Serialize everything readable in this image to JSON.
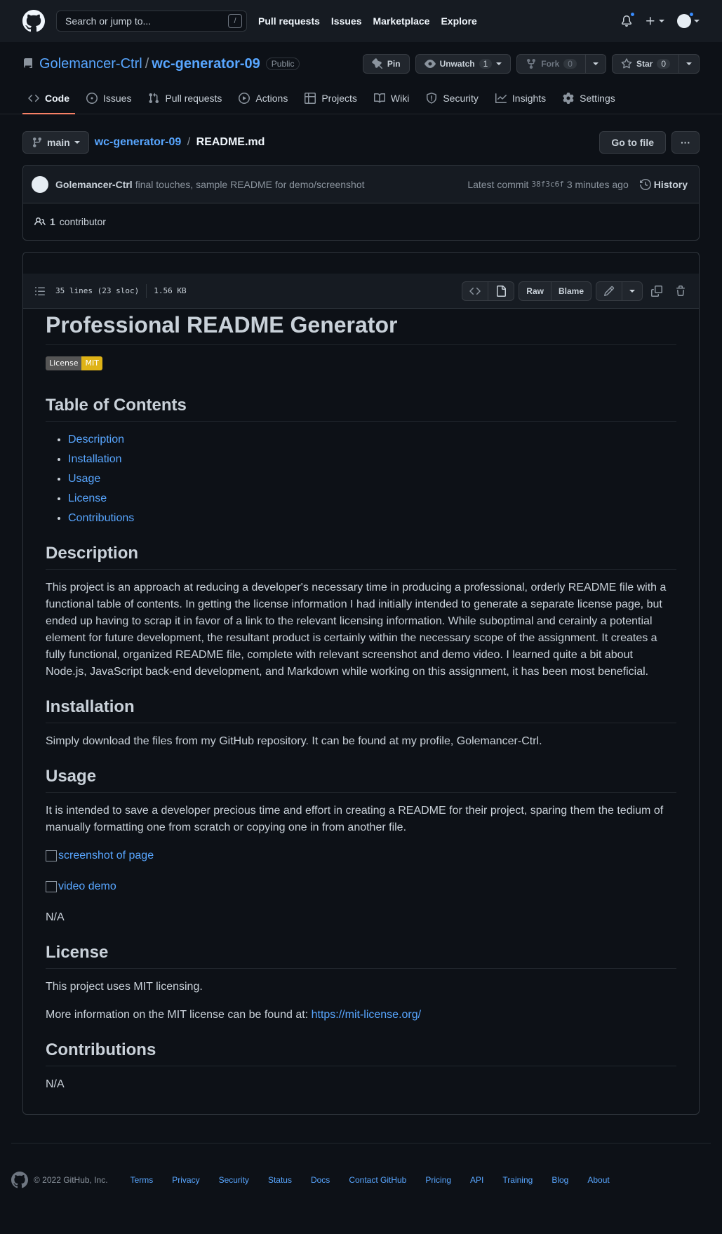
{
  "header": {
    "search_placeholder": "Search or jump to...",
    "slash_key": "/",
    "nav": [
      "Pull requests",
      "Issues",
      "Marketplace",
      "Explore"
    ]
  },
  "repo": {
    "owner": "Golemancer-Ctrl",
    "separator": "/",
    "name": "wc-generator-09",
    "visibility": "Public",
    "pin_label": "Pin",
    "unwatch_label": "Unwatch",
    "unwatch_count": "1",
    "fork_label": "Fork",
    "fork_count": "0",
    "star_label": "Star",
    "star_count": "0"
  },
  "tabs": [
    {
      "label": "Code",
      "icon": "code-icon",
      "active": true
    },
    {
      "label": "Issues",
      "icon": "issue-icon"
    },
    {
      "label": "Pull requests",
      "icon": "pull-request-icon"
    },
    {
      "label": "Actions",
      "icon": "play-icon"
    },
    {
      "label": "Projects",
      "icon": "table-icon"
    },
    {
      "label": "Wiki",
      "icon": "book-icon"
    },
    {
      "label": "Security",
      "icon": "shield-icon"
    },
    {
      "label": "Insights",
      "icon": "graph-icon"
    },
    {
      "label": "Settings",
      "icon": "gear-icon"
    }
  ],
  "file": {
    "branch": "main",
    "repo_crumb": "wc-generator-09",
    "crumb_sep": "/",
    "filename": "README.md",
    "go_to_file": "Go to file",
    "more": "···"
  },
  "commit": {
    "author": "Golemancer-Ctrl",
    "message": "final touches, sample README for demo/screenshot",
    "latest_label": "Latest commit",
    "sha": "38f3c6f",
    "time": "3 minutes ago",
    "history_label": "History",
    "contributors_count": "1",
    "contributors_label": "contributor"
  },
  "fileinfo": {
    "lines": "35 lines (23 sloc)",
    "size": "1.56 KB",
    "raw": "Raw",
    "blame": "Blame"
  },
  "readme": {
    "title": "Professional README Generator",
    "shield_left": "License",
    "shield_right": "MIT",
    "toc_heading": "Table of Contents",
    "toc": [
      "Description",
      "Installation",
      "Usage",
      "License",
      "Contributions"
    ],
    "description_heading": "Description",
    "description": "This project is an approach at reducing a developer's necessary time in producing a professional, orderly README file with a functional table of contents. In getting the license information I had initially intended to generate a separate license page, but ended up having to scrap it in favor of a link to the relevant licensing information. While suboptimal and cerainly a potential element for future development, the resultant product is certainly within the necessary scope of the assignment. It creates a fully functional, organized README file, complete with relevant screenshot and demo video. I learned quite a bit about Node.js, JavaScript back-end development, and Markdown while working on this assignment, it has been most beneficial.",
    "installation_heading": "Installation",
    "installation": "Simply download the files from my GitHub repository. It can be found at my profile, Golemancer-Ctrl.",
    "usage_heading": "Usage",
    "usage": "It is intended to save a developer precious time and effort in creating a README for their project, sparing them the tedium of manually formatting one from scratch or copying one in from another file.",
    "screenshot_alt": "screenshot of page",
    "video_alt": "video demo",
    "usage_na": "N/A",
    "license_heading": "License",
    "license_text": "This project uses MIT licensing.",
    "license_more": "More information on the MIT license can be found at:",
    "license_link": "https://mit-license.org/",
    "contributions_heading": "Contributions",
    "contributions": "N/A"
  },
  "footer": {
    "copyright": "© 2022 GitHub, Inc.",
    "links": [
      "Terms",
      "Privacy",
      "Security",
      "Status",
      "Docs",
      "Contact GitHub",
      "Pricing",
      "API",
      "Training",
      "Blog",
      "About"
    ]
  }
}
